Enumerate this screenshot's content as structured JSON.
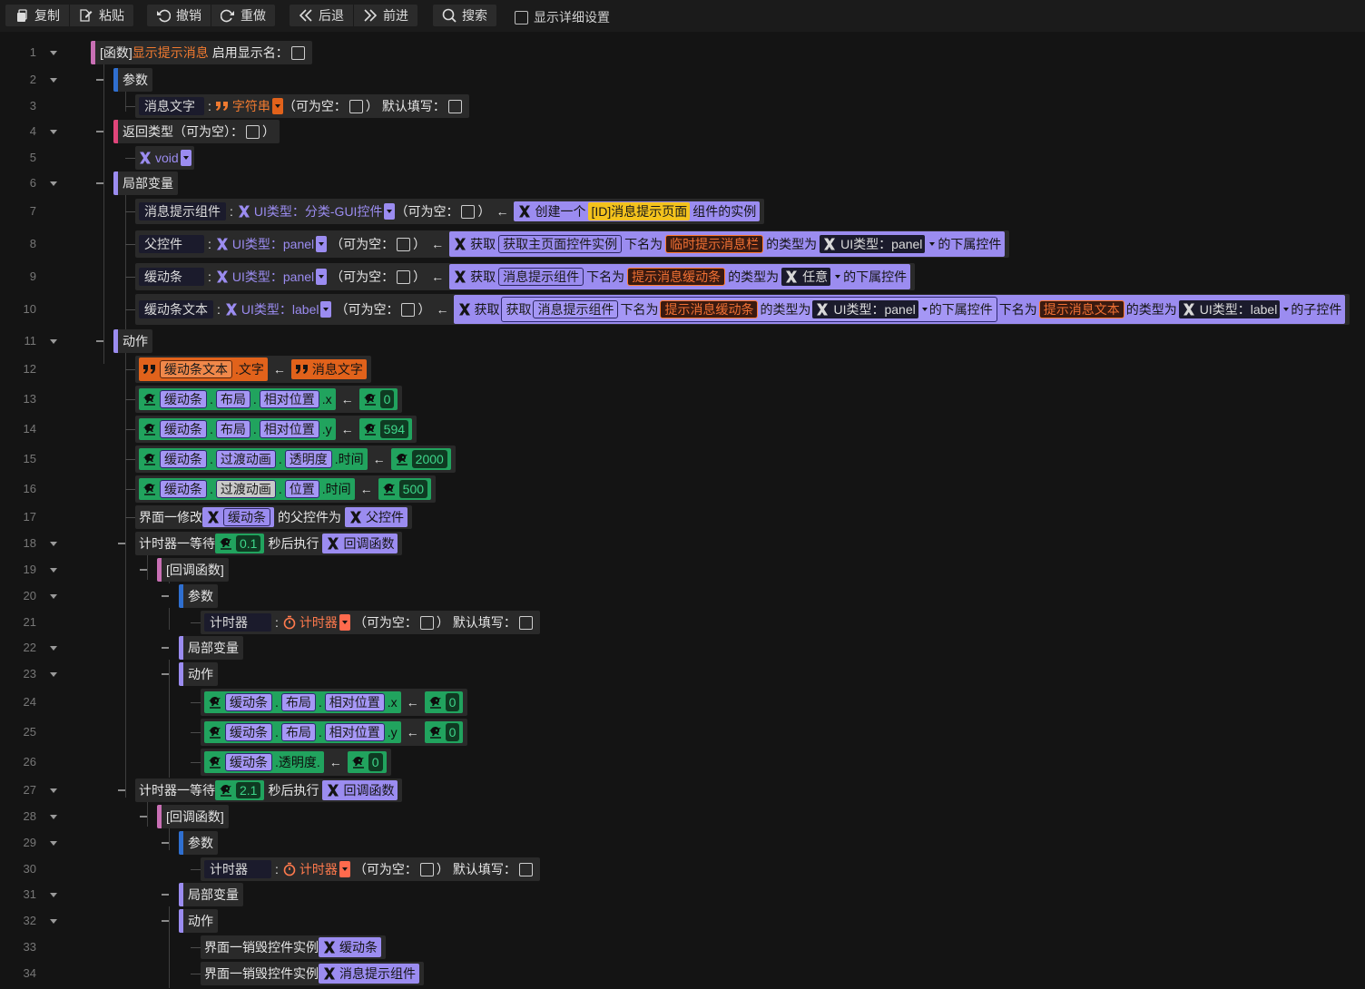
{
  "toolbar": {
    "copy": "复制",
    "paste": "粘贴",
    "undo": "撤销",
    "redo": "重做",
    "back": "后退",
    "forward": "前进",
    "search": "搜索",
    "show_details": "显示详细设置"
  },
  "line_numbers": [
    "1",
    "2",
    "3",
    "4",
    "5",
    "6",
    "7",
    "8",
    "9",
    "10",
    "11",
    "12",
    "13",
    "14",
    "15",
    "16",
    "17",
    "18",
    "19",
    "20",
    "21",
    "22",
    "23",
    "24",
    "25",
    "26",
    "27",
    "28",
    "29",
    "30",
    "31",
    "32",
    "33",
    "34"
  ],
  "code": {
    "l1": {
      "kw": "[函数]",
      "name": "显示提示消息",
      "label": "启用显示名："
    },
    "l2": {
      "label": "参数"
    },
    "l3": {
      "var": "消息文字",
      "colon": ":",
      "type": "字符串",
      "nullable": "（可为空：",
      "close": "）",
      "default": "默认填写："
    },
    "l4": {
      "label": "返回类型（可为空）：",
      "close": "）"
    },
    "l5": {
      "type": "void"
    },
    "l6": {
      "label": "局部变量"
    },
    "l7": {
      "var": "消息提示组件",
      "colon": ":",
      "type": "UI类型：分类-GUI控件",
      "nullable": "（可为空：",
      "close": "）",
      "arrow": "←",
      "create": "创建一个",
      "id": "[ID]消息提示页面",
      "suffix": "组件的实例"
    },
    "l8": {
      "var": "父控件",
      "colon": ":",
      "type": "UI类型：panel",
      "nullable": "（可为空：",
      "close": "）",
      "arrow": "←",
      "get": "获取",
      "inner": "获取主页面控件实例",
      "named": "下名为",
      "target": "临时提示消息栏",
      "typed": "的类型为",
      "t2": "UI类型：panel",
      "sub": "的下属控件"
    },
    "l9": {
      "var": "缓动条",
      "colon": ":",
      "type": "UI类型：panel",
      "nullable": "（可为空：",
      "close": "）",
      "arrow": "←",
      "get": "获取",
      "inner": "消息提示组件",
      "named": "下名为",
      "target": "提示消息缓动条",
      "typed": "的类型为",
      "t2": "任意",
      "sub": "的下属控件"
    },
    "l10": {
      "var": "缓动条文本",
      "colon": ":",
      "type": "UI类型：label",
      "nullable": "（可为空：",
      "close": "）",
      "arrow": "←",
      "get": "获取",
      "get2": "获取",
      "inner": "消息提示组件",
      "named": "下名为",
      "target": "提示消息缓动条",
      "typed": "的类型为",
      "t2": "UI类型：panel",
      "sub": "的下属控件",
      "named2": "下名为",
      "target2": "提示消息文本",
      "typed2": "的类型为",
      "t3": "UI类型：label",
      "child": "的子控件"
    },
    "l11": {
      "label": "动作"
    },
    "l12": {
      "obj": "缓动条文本",
      "prop": ".文字",
      "arrow": "←",
      "val": "消息文字"
    },
    "l13": {
      "obj": "缓动条",
      "dot": ".",
      "p1": "布局",
      "p2": "相对位置",
      "p3": ".x",
      "arrow": "←",
      "val": "0"
    },
    "l14": {
      "obj": "缓动条",
      "dot": ".",
      "p1": "布局",
      "p2": "相对位置",
      "p3": ".y",
      "arrow": "←",
      "val": "594"
    },
    "l15": {
      "obj": "缓动条",
      "dot": ".",
      "p1": "过渡动画",
      "p2": "透明度",
      "p3": ".时间",
      "arrow": "←",
      "val": "2000"
    },
    "l16": {
      "obj": "缓动条",
      "dot": ".",
      "p1": "过渡动画",
      "p2": "位置",
      "p3": ".时间",
      "arrow": "←",
      "val": "500"
    },
    "l17": {
      "prefix": "界面一修改",
      "obj": "缓动条",
      "mid": "的父控件为",
      "target": "父控件"
    },
    "l18": {
      "prefix": "计时器一等待",
      "val": "0.1",
      "mid": "秒后执行",
      "target": "回调函数"
    },
    "l19": {
      "label": "[回调函数]"
    },
    "l20": {
      "label": "参数"
    },
    "l21": {
      "var": "计时器",
      "colon": ":",
      "type": "计时器",
      "nullable": "（可为空：",
      "close": "）",
      "default": "默认填写："
    },
    "l22": {
      "label": "局部变量"
    },
    "l23": {
      "label": "动作"
    },
    "l24": {
      "obj": "缓动条",
      "dot": ".",
      "p1": "布局",
      "p2": "相对位置",
      "p3": ".x",
      "arrow": "←",
      "val": "0"
    },
    "l25": {
      "obj": "缓动条",
      "dot": ".",
      "p1": "布局",
      "p2": "相对位置",
      "p3": ".y",
      "arrow": "←",
      "val": "0"
    },
    "l26": {
      "obj": "缓动条",
      "prop": ".透明度.",
      "arrow": "←",
      "val": "0"
    },
    "l27": {
      "prefix": "计时器一等待",
      "val": "2.1",
      "mid": "秒后执行",
      "target": "回调函数"
    },
    "l28": {
      "label": "[回调函数]"
    },
    "l29": {
      "label": "参数"
    },
    "l30": {
      "var": "计时器",
      "colon": ":",
      "type": "计时器",
      "nullable": "（可为空：",
      "close": "）",
      "default": "默认填写："
    },
    "l31": {
      "label": "局部变量"
    },
    "l32": {
      "label": "动作"
    },
    "l33": {
      "prefix": "界面一销毁控件实例",
      "target": "缓动条"
    },
    "l34": {
      "prefix": "界面一销毁控件实例",
      "target": "消息提示组件"
    }
  },
  "colors": {
    "background": "#141414",
    "function": "#c86fb4",
    "params": "#2f6fd0",
    "return": "#e0457a",
    "block": "#9b8cf0",
    "number": "#21a35e",
    "string": "#e1621b",
    "id": "#f3c21d"
  },
  "icons": [
    "copy-icon",
    "paste-icon",
    "undo-icon",
    "redo-icon",
    "back-icon",
    "forward-icon",
    "search-icon",
    "variable-x-icon",
    "string-quote-icon",
    "number-bird-icon",
    "timer-icon"
  ]
}
